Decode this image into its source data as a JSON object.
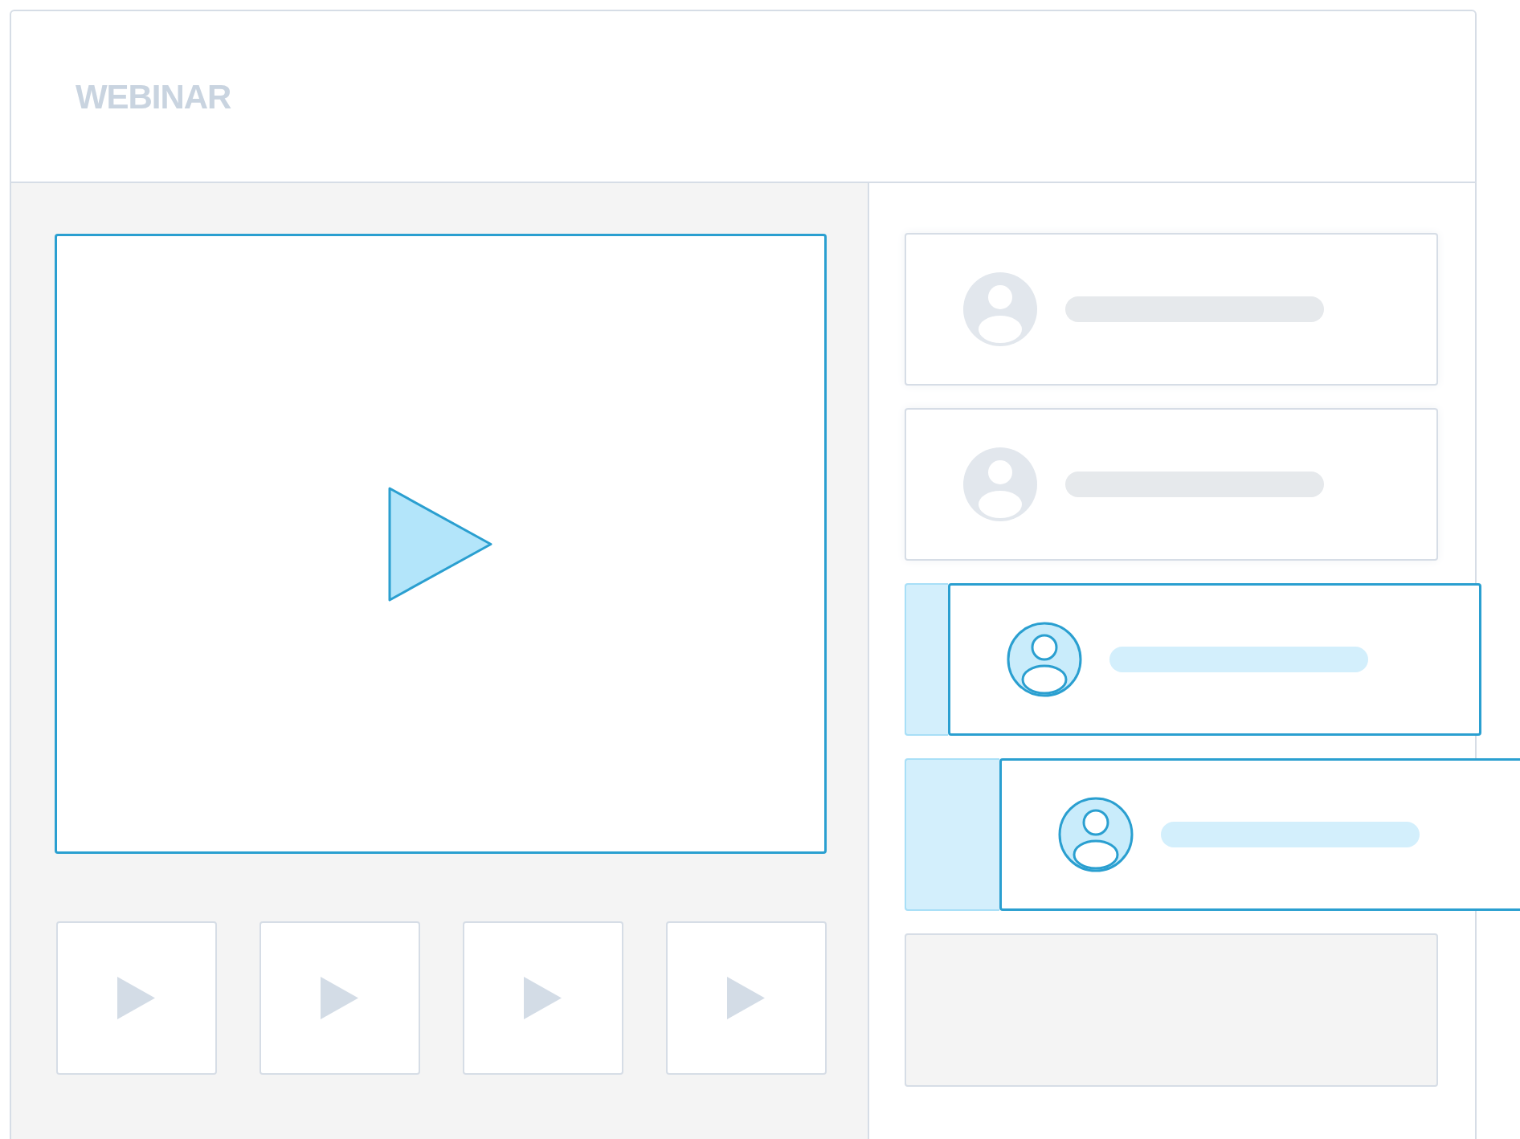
{
  "window": {
    "title": "WEBINAR"
  },
  "participants": [
    {
      "selected": false
    },
    {
      "selected": false
    },
    {
      "selected": true
    },
    {
      "selected": true
    }
  ]
}
